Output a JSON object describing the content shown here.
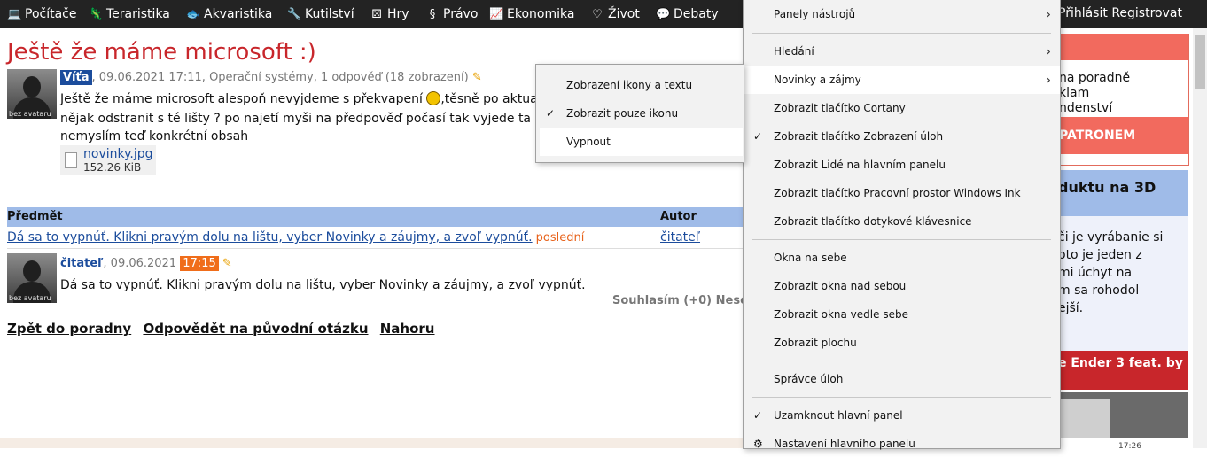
{
  "nav": {
    "items": [
      {
        "label": "Počítače",
        "icon": "laptop-icon"
      },
      {
        "label": "Teraristika",
        "icon": "lizard-icon"
      },
      {
        "label": "Akvaristika",
        "icon": "fish-icon"
      },
      {
        "label": "Kutilství",
        "icon": "wrench-icon"
      },
      {
        "label": "Hry",
        "icon": "dice-icon"
      },
      {
        "label": "Právo",
        "icon": "paragraph-icon"
      },
      {
        "label": "Ekonomika",
        "icon": "chart-icon"
      },
      {
        "label": "Život",
        "icon": "heart-icon"
      },
      {
        "label": "Debaty",
        "icon": "chat-icon"
      }
    ],
    "login": "Přihlásit",
    "register": "Registrovat"
  },
  "question": {
    "title": "Ještě že máme microsoft :)",
    "avatar_label": "bez avataru",
    "author": "Víťa",
    "meta": ", 09.06.2021 17:11, Operační systémy, 1 odpověď (18 zobrazení)",
    "line1a": "Ještě že máme microsoft alespoň nevyjdeme s překvapení",
    "line1b": ",těsně po aktua",
    "line2": "nějak odstranit s té lišty ? po najetí myši na předpověď počasí tak vyjede ta",
    "line3": "nemyslím teď konkrétní obsah",
    "attachment": {
      "name": "novinky.jpg",
      "size": "152.26 KiB"
    }
  },
  "answers": {
    "col_subject": "Předmět",
    "col_author": "Autor",
    "row": {
      "subject": "Dá sa to vypnúť. Klikni pravým dolu na lištu, vyber Novinky a záujmy, a zvoľ vypnúť.",
      "tag": "poslední",
      "author": "čitateľ"
    }
  },
  "reply": {
    "avatar_label": "bez avataru",
    "author": "čitateľ",
    "date": ", 09.06.2021",
    "time": "17:15",
    "text": "Dá sa to vypnúť. Klikni pravým dolu na lištu, vyber Novinky a záujmy, a zvoľ vypnúť.",
    "reaction": "Souhlasím (+0)  Neso"
  },
  "bottom_links": [
    "Zpět do poradny",
    "Odpovědět na původní otázku",
    "Nahoru"
  ],
  "sidebar": {
    "box1": {
      "lines": [
        "na poradně",
        "klam",
        "ndenství"
      ],
      "button": "PATRONEM"
    },
    "box2": {
      "heading": "duktu na 3D",
      "lines": [
        "či je vyrábanie si",
        "oto je jeden z",
        "mi úchyt na",
        "m sa rohodol",
        "ejší."
      ]
    },
    "box3": {
      "heading": "e Ender 3 feat. by"
    }
  },
  "taskbar": {
    "clock": "17:26"
  },
  "context_menu": {
    "items": [
      {
        "label": "Panely nástrojů",
        "submenu": true,
        "checked": false
      },
      {
        "label": "Hledání",
        "submenu": true,
        "checked": false
      },
      {
        "label": "Novinky a zájmy",
        "submenu": true,
        "checked": false,
        "hover": true
      },
      {
        "label": "Zobrazit tlačítko Cortany",
        "submenu": false,
        "checked": false
      },
      {
        "label": "Zobrazit tlačítko Zobrazení úloh",
        "submenu": false,
        "checked": true
      },
      {
        "label": "Zobrazit Lidé na hlavním panelu",
        "submenu": false,
        "checked": false
      },
      {
        "label": "Zobrazit tlačítko Pracovní prostor Windows Ink",
        "submenu": false,
        "checked": false
      },
      {
        "label": "Zobrazit tlačítko dotykové klávesnice",
        "submenu": false,
        "checked": false
      },
      {
        "label": "Okna na sebe",
        "submenu": false,
        "checked": false
      },
      {
        "label": "Zobrazit okna nad sebou",
        "submenu": false,
        "checked": false
      },
      {
        "label": "Zobrazit okna vedle sebe",
        "submenu": false,
        "checked": false
      },
      {
        "label": "Zobrazit plochu",
        "submenu": false,
        "checked": false
      },
      {
        "label": "Správce úloh",
        "submenu": false,
        "checked": false
      },
      {
        "label": "Uzamknout hlavní panel",
        "submenu": false,
        "checked": true
      },
      {
        "label": "Nastavení hlavního panelu",
        "submenu": false,
        "checked": false,
        "icon": "gear-icon"
      }
    ],
    "check_glyph": "✓",
    "chevron_glyph": "›"
  },
  "submenu": {
    "items": [
      {
        "label": "Zobrazení ikony a textu",
        "checked": false
      },
      {
        "label": "Zobrazit pouze ikonu",
        "checked": true
      },
      {
        "label": "Vypnout",
        "checked": false,
        "hover": true
      }
    ]
  }
}
